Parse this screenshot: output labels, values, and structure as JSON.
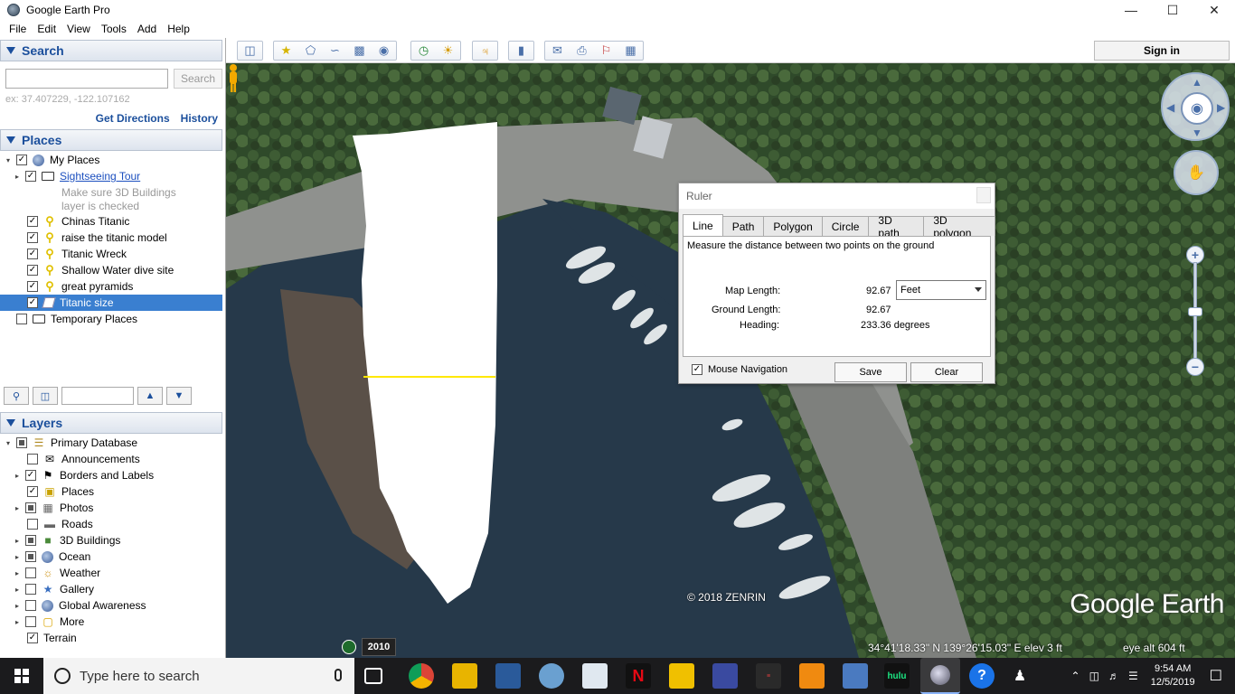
{
  "window": {
    "title": "Google Earth Pro",
    "minimize": "—",
    "maximize": "☐",
    "close": "✕"
  },
  "menu": {
    "items": [
      "File",
      "Edit",
      "View",
      "Tools",
      "Add",
      "Help"
    ]
  },
  "search": {
    "header": "Search",
    "input_value": "",
    "button": "Search",
    "hint": "ex: 37.407229, -122.107162",
    "get_directions": "Get Directions",
    "history": "History"
  },
  "places": {
    "header": "Places",
    "my_places": "My Places",
    "sightseeing": "Sightseeing Tour",
    "sightseeing_desc1": "Make sure 3D Buildings",
    "sightseeing_desc2": "layer is checked",
    "items": [
      "Chinas Titanic",
      "raise the titanic model",
      "Titanic Wreck",
      "Shallow Water dive site",
      "great pyramids",
      "Titanic size"
    ],
    "temporary": "Temporary Places"
  },
  "layers": {
    "header": "Layers",
    "primary": "Primary Database",
    "items": [
      "Announcements",
      "Borders and Labels",
      "Places",
      "Photos",
      "Roads",
      "3D Buildings",
      "Ocean",
      "Weather",
      "Gallery",
      "Global Awareness",
      "More"
    ],
    "terrain": "Terrain"
  },
  "toolbar": {
    "sign_in": "Sign in"
  },
  "ruler": {
    "title": "Ruler",
    "tabs": [
      "Line",
      "Path",
      "Polygon",
      "Circle",
      "3D path",
      "3D polygon"
    ],
    "instruction": "Measure the distance between two points on the ground",
    "map_length_label": "Map Length:",
    "map_length_value": "92.67",
    "unit": "Feet",
    "ground_length_label": "Ground Length:",
    "ground_length_value": "92.67",
    "heading_label": "Heading:",
    "heading_value": "233.36 degrees",
    "mouse_nav": "Mouse Navigation",
    "save": "Save",
    "clear": "Clear"
  },
  "map": {
    "copyright": "© 2018 ZENRIN",
    "logo": "Google Earth",
    "year": "2010",
    "coords": "34°41'18.33\" N   139°26'15.03\" E   elev      3 ft",
    "eye_alt": "eye alt    604 ft"
  },
  "taskbar": {
    "search_placeholder": "Type here to search",
    "time": "9:54 AM",
    "date": "12/5/2019"
  }
}
